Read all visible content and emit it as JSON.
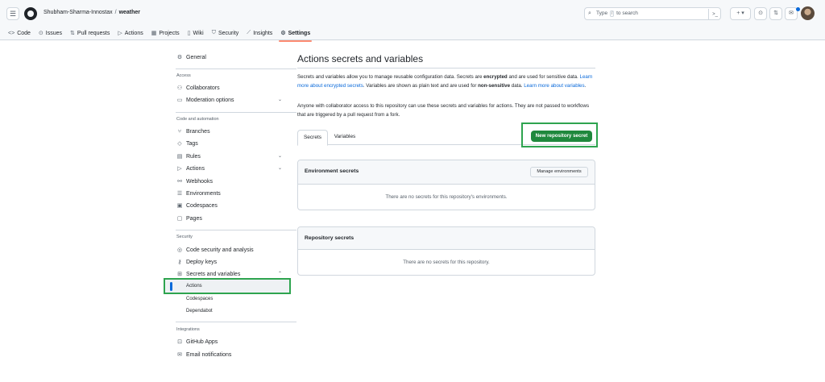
{
  "header": {
    "owner": "Shubham-Sharma-Innostax",
    "separator": "/",
    "repo": "weather",
    "search_prefix": "Type",
    "search_key": "/",
    "search_suffix": "to search",
    "command_icon": ">_",
    "plus_label": "+ ▾"
  },
  "repo_nav": [
    {
      "label": "Code",
      "icon": "code-icon",
      "glyph": "<>"
    },
    {
      "label": "Issues",
      "icon": "issue-icon",
      "glyph": "⊙"
    },
    {
      "label": "Pull requests",
      "icon": "pull-request-icon",
      "glyph": "⇅"
    },
    {
      "label": "Actions",
      "icon": "play-icon",
      "glyph": "▷"
    },
    {
      "label": "Projects",
      "icon": "table-icon",
      "glyph": "▦"
    },
    {
      "label": "Wiki",
      "icon": "book-icon",
      "glyph": "▯"
    },
    {
      "label": "Security",
      "icon": "shield-icon",
      "glyph": "⛉"
    },
    {
      "label": "Insights",
      "icon": "graph-icon",
      "glyph": "⟋"
    },
    {
      "label": "Settings",
      "icon": "gear-icon",
      "glyph": "⚙"
    }
  ],
  "sidebar": {
    "general": "General",
    "access_heading": "Access",
    "collaborators": "Collaborators",
    "moderation": "Moderation options",
    "code_heading": "Code and automation",
    "branches": "Branches",
    "tags": "Tags",
    "rules": "Rules",
    "actions": "Actions",
    "webhooks": "Webhooks",
    "environments": "Environments",
    "codespaces": "Codespaces",
    "pages": "Pages",
    "security_heading": "Security",
    "code_security": "Code security and analysis",
    "deploy_keys": "Deploy keys",
    "secrets": "Secrets and variables",
    "sub_actions": "Actions",
    "sub_codespaces": "Codespaces",
    "sub_dependabot": "Dependabot",
    "integrations_heading": "Integrations",
    "github_apps": "GitHub Apps",
    "email_notifications": "Email notifications"
  },
  "main": {
    "title": "Actions secrets and variables",
    "p1_a": "Secrets and variables allow you to manage reusable configuration data. Secrets are ",
    "p1_b": "encrypted",
    "p1_c": " and are used for sensitive data. ",
    "p1_link1": "Learn more about encrypted secrets",
    "p1_d": ". Variables are shown as plain text and are used for ",
    "p1_e": "non-sensitive",
    "p1_f": " data. ",
    "p1_link2": "Learn more about variables",
    "p1_g": ".",
    "p2": "Anyone with collaborator access to this repository can use these secrets and variables for actions. They are not passed to workflows that are triggered by a pull request from a fork.",
    "tab_secrets": "Secrets",
    "tab_variables": "Variables",
    "new_secret": "New repository secret",
    "env_title": "Environment secrets",
    "manage_env": "Manage environments",
    "env_empty": "There are no secrets for this repository's environments.",
    "repo_title": "Repository secrets",
    "repo_empty": "There are no secrets for this repository."
  },
  "colors": {
    "primary_button": "#1f883d",
    "link": "#0969da",
    "highlight_annotation": "#2ea44f",
    "active_tab_underline": "#fd8c73"
  }
}
